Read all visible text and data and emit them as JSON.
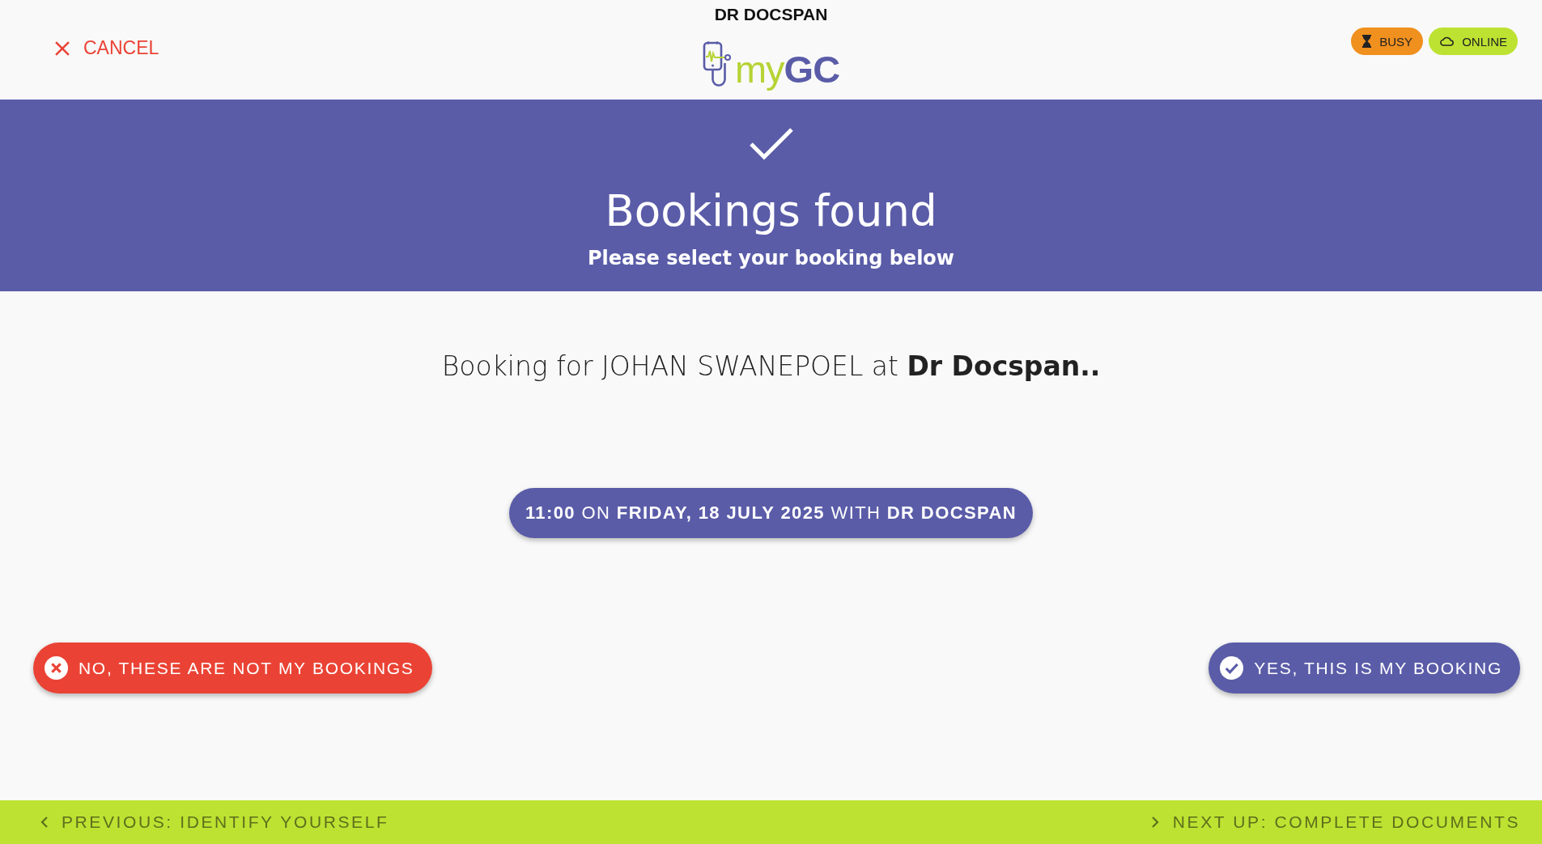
{
  "header": {
    "cancel_button": "CANCEL",
    "practice_name": "DR DOCSPAN",
    "logo_text": "my**GC**",
    "status_badges": [
      {
        "label": "BUSY",
        "kind": "busy",
        "color": "#f0901f"
      },
      {
        "label": "ONLINE",
        "kind": "online",
        "color": "#bde232"
      }
    ]
  },
  "banner": {
    "title": "Bookings found",
    "subtitle": "Please select your booking below"
  },
  "booking_intro": "Booking for JOHAN SWANEPOEL at **Dr Docspan..**",
  "booking_option": "**11:00** ON **FRIDAY, 18 JULY 2025** WITH **DR DOCSPAN**",
  "actions": [
    {
      "label": "NO, THESE ARE NOT MY BOOKINGS",
      "kind": "reject"
    },
    {
      "label": "YES, THIS IS MY BOOKING",
      "kind": "confirm"
    }
  ],
  "footer": {
    "previous": "PREVIOUS: IDENTIFY YOURSELF",
    "next": "NEXT UP: COMPLETE DOCUMENTS"
  }
}
